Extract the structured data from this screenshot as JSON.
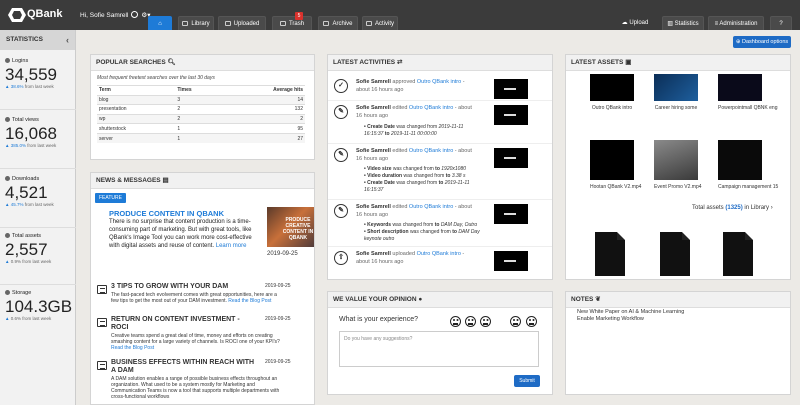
{
  "app": {
    "name": "QBank",
    "greeting": "Hi, Sofie Samrell"
  },
  "nav": {
    "home": "",
    "library": "Library",
    "uploaded": "Uploaded",
    "trash": "Trash",
    "trash_count": "5",
    "archive": "Archive",
    "activity": "Activity"
  },
  "top_right": {
    "upload": "Upload",
    "statistics": "Statistics",
    "administration": "Administration",
    "help": "?"
  },
  "dashboard_options": "Dashboard options",
  "sidebar": {
    "title": "STATISTICS",
    "stats": [
      {
        "label": "Logins",
        "value": "34,559",
        "change": "38.6%",
        "change_text": "from last week"
      },
      {
        "label": "Total views",
        "value": "16,068",
        "change": "385.0%",
        "change_text": "from last week"
      },
      {
        "label": "Downloads",
        "value": "4,521",
        "change": "45.7%",
        "change_text": "from last week"
      },
      {
        "label": "Total assets",
        "value": "2,557",
        "change": "0.9%",
        "change_text": "from last week"
      },
      {
        "label": "Storage",
        "value": "104.3GB",
        "change": "0.6%",
        "change_text": "from last week"
      }
    ]
  },
  "popular_searches": {
    "title": "POPULAR SEARCHES",
    "subtitle": "Most frequent freetext searches over the last 30 days",
    "headers": [
      "Term",
      "Times",
      "Average hits"
    ],
    "rows": [
      [
        "blog",
        "3",
        "14"
      ],
      [
        "presentation",
        "2",
        "132"
      ],
      [
        "wp",
        "2",
        "2"
      ],
      [
        "shutterstock",
        "1",
        "95"
      ],
      [
        "server",
        "1",
        "27"
      ]
    ]
  },
  "news": {
    "title": "NEWS & MESSAGES",
    "feature_label": "FEATURE",
    "featured": {
      "title": "PRODUCE CONTENT IN QBANK",
      "body": "There is no surprise that content production is a time-consuming part of marketing. But with great tools, like QBank's Image Tool you can work more cost-effective with digital assets and reuse of content.",
      "link": "Learn more",
      "image_text": "PRODUCE CREATIVE CONTENT IN QBANK",
      "date": "2019-09-25"
    },
    "articles": [
      {
        "title": "3 TIPS TO GROW WITH YOUR DAM",
        "date": "2019-09-25",
        "body": "The fast-paced tech evolvement comes with great opportunities, here are a few tips to get the most out of your DAM investment.",
        "link": "Read the Blog Post"
      },
      {
        "title": "RETURN ON CONTENT INVESTMENT - ROCI",
        "date": "2019-09-25",
        "body": "Creative teams spend a great deal of time, money and efforts on creating smashing content for a large variety of channels. Is ROCI one of your KPI's?",
        "link": "Read the Blog Post"
      },
      {
        "title": "BUSINESS EFFECTS WITHIN REACH WITH A DAM",
        "date": "2019-09-25",
        "body": "A DAM solution enables a range of possible business effects throughout an organization. What used to be a system mostly for Marketing and Communication Teams is now a tool that supports multiple departments with cross-functional workflows",
        "link": ""
      }
    ]
  },
  "activities": {
    "title": "LATEST ACTIVITIES",
    "items": [
      {
        "icon": "check",
        "user": "Sofie Samrell",
        "action": "approved",
        "asset": "Outro QBank intro",
        "time": "about 16 hours ago",
        "details": []
      },
      {
        "icon": "pencil",
        "user": "Sofie Samrell",
        "action": "edited",
        "asset": "Outro QBank intro",
        "time": "about 16 hours ago",
        "details": [
          {
            "field": "Create Date",
            "text": "was changed from",
            "from": "2019-11-11 16:15:37",
            "to": "2019-11-11 00:00:00"
          }
        ]
      },
      {
        "icon": "pencil",
        "user": "Sofie Samrell",
        "action": "edited",
        "asset": "Outro QBank intro",
        "time": "about 16 hours ago",
        "details": [
          {
            "field": "Video size",
            "text": "was changed from",
            "from": "",
            "to": "1920x1080"
          },
          {
            "field": "Video duration",
            "text": "was changed from",
            "from": "",
            "to": "3.38 s"
          },
          {
            "field": "Create Date",
            "text": "was changed from",
            "from": "",
            "to": "2019-11-11 16:15:37"
          }
        ]
      },
      {
        "icon": "pencil",
        "user": "Sofie Samrell",
        "action": "edited",
        "asset": "Outro QBank intro",
        "time": "about 16 hours ago",
        "details": [
          {
            "field": "Keywords",
            "text": "was changed from",
            "from": "",
            "to": "DAM Day, Outro"
          },
          {
            "field": "Short description",
            "text": "was changed from",
            "from": "",
            "to": "DAM Day keynote outro"
          }
        ]
      },
      {
        "icon": "upload",
        "user": "Sofie Samrell",
        "action": "uploaded",
        "asset": "Outro QBank intro",
        "time": "about 16 hours ago",
        "details": []
      }
    ]
  },
  "opinion": {
    "title": "WE VALUE YOUR OPINION",
    "question": "What is your experience?",
    "placeholder": "Do you have any suggestions?",
    "submit": "Submit"
  },
  "assets": {
    "title": "LATEST ASSETS",
    "items": [
      {
        "label": "Outro QBank intro"
      },
      {
        "label": "Career hiring some"
      },
      {
        "label": "Powerpointmall QBNK eng"
      },
      {
        "label": "Hootan QBank V2.mp4"
      },
      {
        "label": "Event Promo V2.mp4"
      },
      {
        "label": "Campaign management 15"
      }
    ],
    "total_prefix": "Total assets",
    "total_count": "(1325)",
    "total_suffix": "in Library"
  },
  "notes": {
    "title": "NOTES",
    "lines": [
      "New White Paper on AI & Machine Learning",
      "Enable Marketing Workflow"
    ]
  }
}
